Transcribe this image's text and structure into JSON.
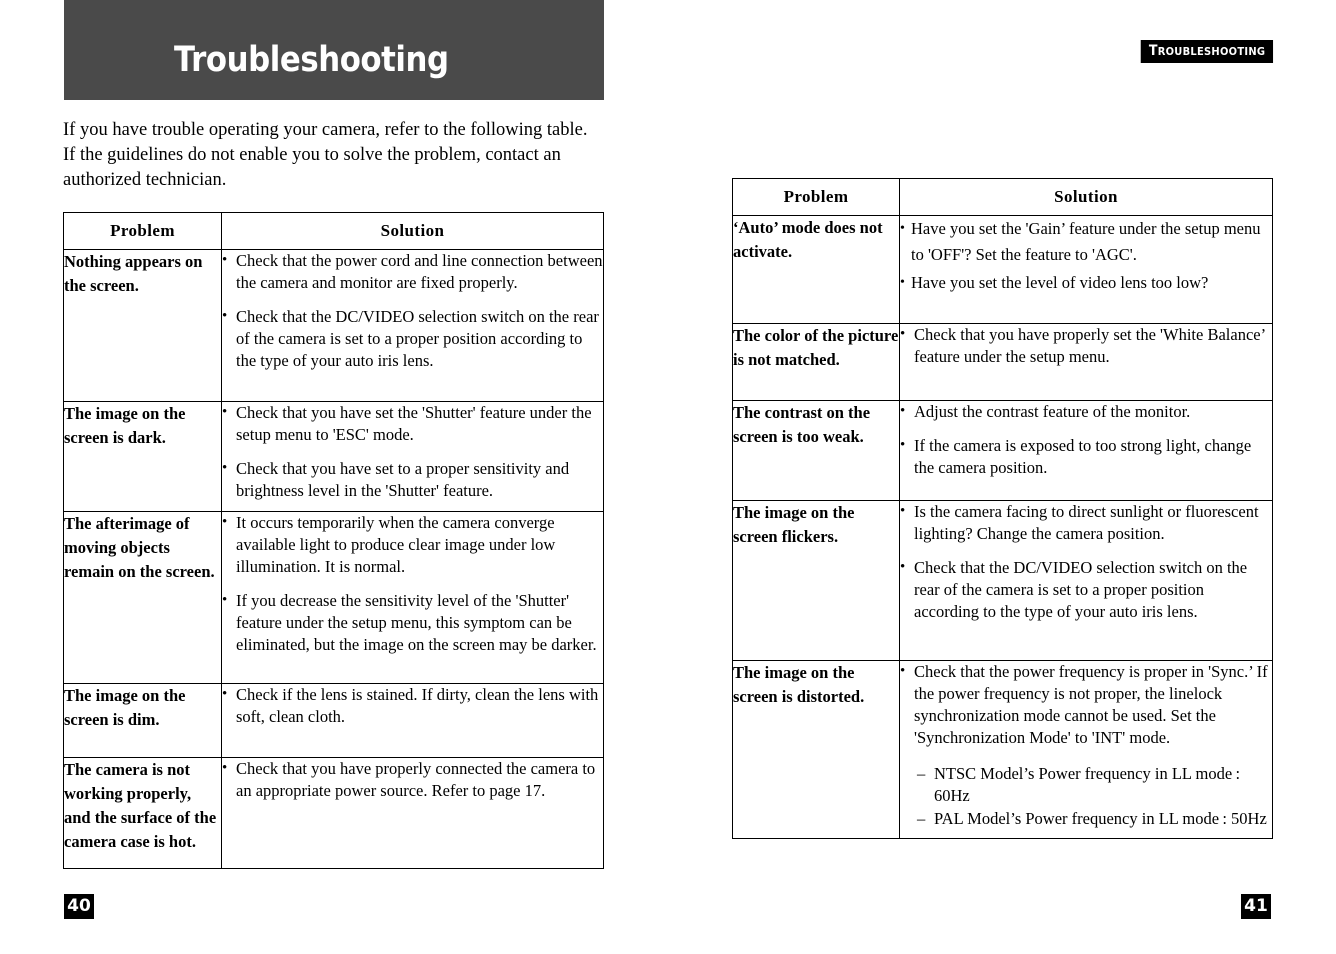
{
  "left_page": {
    "banner_title": "Troubleshooting",
    "intro": "If you have trouble operating your camera, refer to the following table. If the guidelines do not enable  you to solve the problem, contact an authorized technician.",
    "folio": "40",
    "table": {
      "headers": [
        "Problem",
        "Solution"
      ],
      "rows": [
        {
          "problem": "Nothing appears on the screen.",
          "solutions": [
            "Check that the power cord and line connection between the camera and monitor are fixed properly.",
            "Check that the DC/VIDEO selection switch on the rear of the camera is set to a proper position according to the type of your auto iris lens."
          ]
        },
        {
          "problem": "The image on the screen is dark.",
          "solutions": [
            "Check that you have set the 'Shutter'  feature under the setup menu to 'ESC' mode.",
            "Check that you have set to a proper sensitivity and brightness level in the 'Shutter' feature."
          ]
        },
        {
          "problem": "The afterimage of moving objects remain on the screen.",
          "solutions": [
            "It occurs temporarily when the camera converge available light to produce clear image under low illumination. It is normal.",
            "If you decrease the sensitivity level of the 'Shutter' feature under the setup menu, this symptom can be eliminated, but the image on the screen may be darker."
          ]
        },
        {
          "problem": "The image on the screen is dim.",
          "solutions": [
            "Check if the lens is stained. If dirty, clean the lens with soft, clean cloth."
          ]
        },
        {
          "problem": "The camera is not working properly, and the surface of the camera case is hot.",
          "solutions": [
            "Check that you have properly connected the camera to an appropriate power source. Refer to page 17."
          ]
        }
      ]
    }
  },
  "right_page": {
    "running_head_cap": "T",
    "running_head_rest": "ROUBLESHOOTING",
    "folio": "41",
    "table": {
      "headers": [
        "Problem",
        "Solution"
      ],
      "rows": [
        {
          "problem": "‘Auto’ mode does not activate.",
          "solutions": [
            "Have you set the 'Gain’ feature under the setup menu to 'OFF'? Set the feature to 'AGC'.",
            "Have you set the level of video lens too low?"
          ]
        },
        {
          "problem": "The color of the picture is not matched.",
          "solutions": [
            "Check that you have properly set the 'White Balance’ feature under the setup menu."
          ]
        },
        {
          "problem": "The contrast on the screen is too weak.",
          "solutions": [
            "Adjust the contrast feature of the monitor.",
            "If the camera is exposed to too strong light, change the camera position."
          ]
        },
        {
          "problem": "The image on the screen flickers.",
          "solutions": [
            "Is the camera facing to direct sunlight or fluorescent lighting? Change the camera position.",
            "Check that the DC/VIDEO selection switch on the rear of the camera is set to a proper position according to the type of your auto iris lens."
          ]
        },
        {
          "problem": "The image on the screen is distorted.",
          "solutions": [
            "Check that the power frequency is proper in 'Sync.’ If the power frequency is not proper, the linelock synchronization mode cannot be used. Set the 'Synchronization Mode' to 'INT' mode."
          ],
          "notes": [
            "NTSC Model’s Power frequency in LL mode : 60Hz",
            "PAL Model’s Power frequency in LL mode : 50Hz"
          ]
        }
      ]
    }
  },
  "colors": {
    "banner": "#4a4a4a",
    "folio_bg": "#000000",
    "text": "#000000"
  }
}
